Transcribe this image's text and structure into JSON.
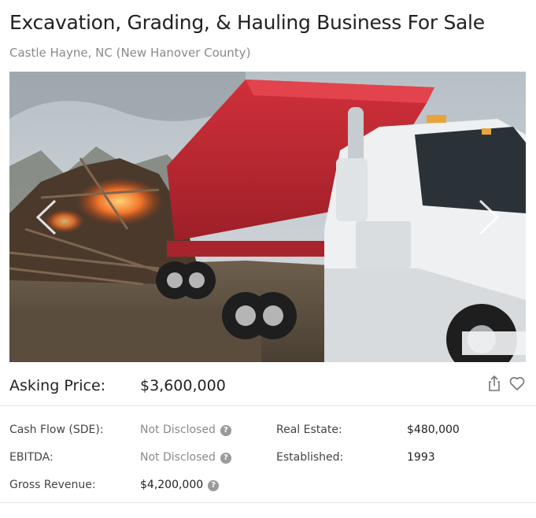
{
  "listing": {
    "title": "Excavation, Grading, & Hauling Business For Sale",
    "location": "Castle Hayne, NC (New Hanover County)"
  },
  "gallery": {
    "image_alt": "Red dump truck hauling land-clearing debris next to a burning brush pile",
    "prev_icon": "chevron-left-icon",
    "next_icon": "chevron-right-icon"
  },
  "price": {
    "label": "Asking Price:",
    "value": "$3,600,000",
    "share_icon": "share-icon",
    "favorite_icon": "heart-icon"
  },
  "details": {
    "cash_flow": {
      "label": "Cash Flow (SDE):",
      "value": "Not Disclosed"
    },
    "ebitda": {
      "label": "EBITDA:",
      "value": "Not Disclosed"
    },
    "gross_revenue": {
      "label": "Gross Revenue:",
      "value": "$4,200,000"
    },
    "real_estate": {
      "label": "Real Estate:",
      "value": "$480,000"
    },
    "established": {
      "label": "Established:",
      "value": "1993"
    },
    "help_glyph": "?"
  }
}
